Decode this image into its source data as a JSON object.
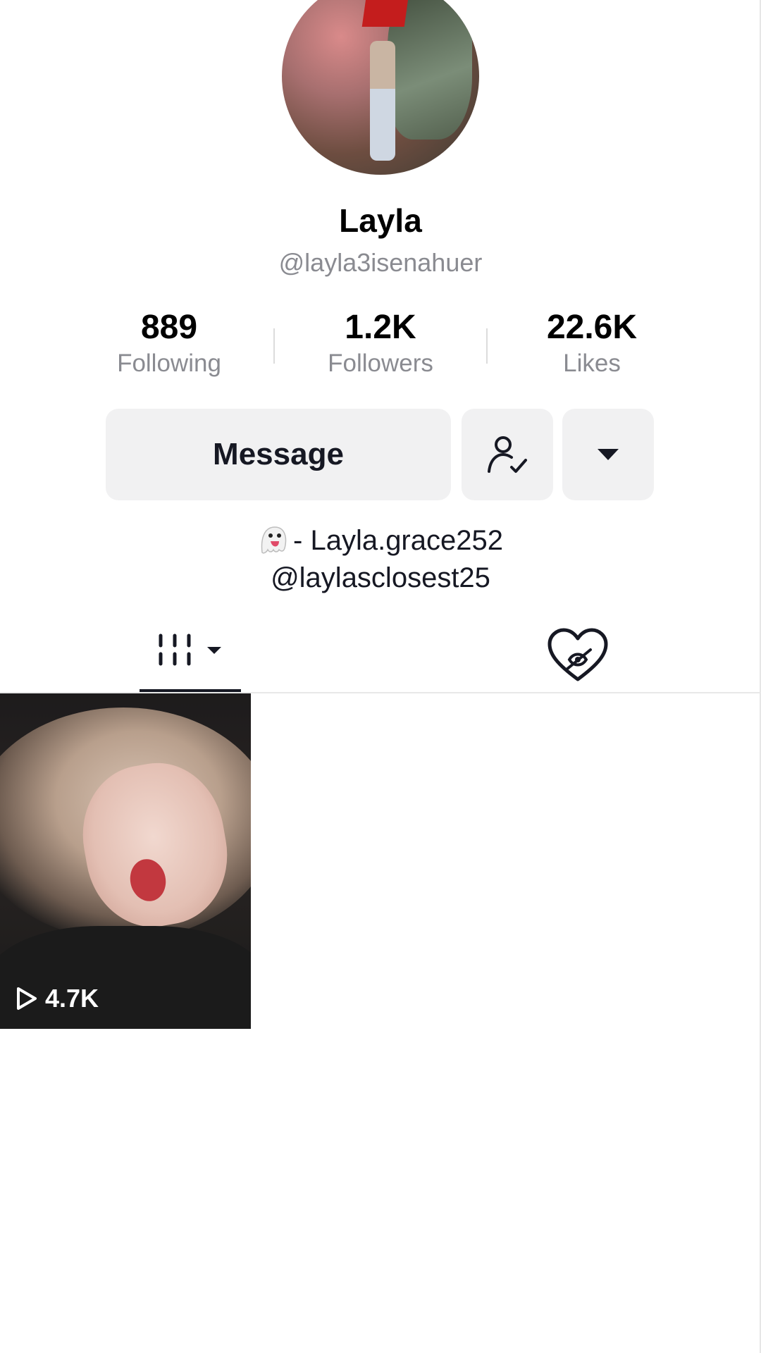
{
  "profile": {
    "display_name": "Layla",
    "username": "@layla3isenahuer"
  },
  "stats": {
    "following": {
      "value": "889",
      "label": "Following"
    },
    "followers": {
      "value": "1.2K",
      "label": "Followers"
    },
    "likes": {
      "value": "22.6K",
      "label": "Likes"
    }
  },
  "actions": {
    "message_label": "Message",
    "friend_icon": "user-check-icon",
    "more_icon": "caret-down-icon"
  },
  "bio": {
    "line1": "- Layla.grace252",
    "line1_icon": "ghost-emoji",
    "line2": "@laylasclosest25"
  },
  "tabs": [
    {
      "icon": "videos-grid-icon",
      "selected": true
    },
    {
      "icon": "liked-hidden-icon",
      "selected": false
    }
  ],
  "videos": [
    {
      "views": "4.7K",
      "icon": "play-icon"
    }
  ]
}
